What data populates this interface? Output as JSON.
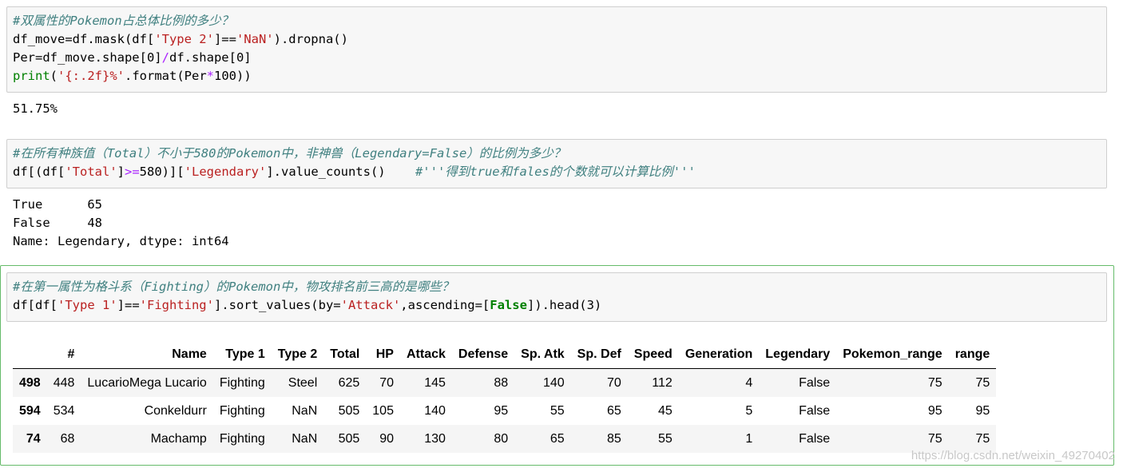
{
  "cell1": {
    "lines": [
      [
        {
          "c": "cm",
          "t": "#双属性的Pokemon占总体比例的多少？"
        }
      ],
      [
        {
          "c": "",
          "t": "df_move=df.mask(df["
        },
        {
          "c": "st",
          "t": "'Type 2'"
        },
        {
          "c": "",
          "t": "]=="
        },
        {
          "c": "st",
          "t": "'NaN'"
        },
        {
          "c": "",
          "t": ").dropna()"
        }
      ],
      [
        {
          "c": "",
          "t": "Per=df_move.shape[0]"
        },
        {
          "c": "op",
          "t": "/"
        },
        {
          "c": "",
          "t": "df.shape[0]"
        }
      ],
      [
        {
          "c": "bi",
          "t": "print"
        },
        {
          "c": "",
          "t": "("
        },
        {
          "c": "st",
          "t": "'{:.2f}%'"
        },
        {
          "c": "",
          "t": ".format(Per"
        },
        {
          "c": "op",
          "t": "*"
        },
        {
          "c": "",
          "t": "100))"
        }
      ]
    ],
    "output": [
      "51.75%"
    ]
  },
  "cell2": {
    "lines": [
      [
        {
          "c": "cm",
          "t": "#在所有种族值（Total）不小于580的Pokemon中，非神兽（Legendary=False）的比例为多少？"
        }
      ],
      [
        {
          "c": "",
          "t": "df[(df["
        },
        {
          "c": "st",
          "t": "'Total'"
        },
        {
          "c": "",
          "t": "]"
        },
        {
          "c": "op",
          "t": ">="
        },
        {
          "c": "",
          "t": "580)]["
        },
        {
          "c": "st",
          "t": "'Legendary'"
        },
        {
          "c": "",
          "t": "].value_counts()    "
        },
        {
          "c": "cm",
          "t": "#'''得到true和fales的个数就可以计算比例'''"
        }
      ]
    ],
    "output": [
      "True      65",
      "False     48",
      "Name: Legendary, dtype: int64"
    ]
  },
  "cell3": {
    "lines": [
      [
        {
          "c": "cm",
          "t": "#在第一属性为格斗系（Fighting）的Pokemon中，物攻排名前三高的是哪些？"
        }
      ],
      [
        {
          "c": "",
          "t": "df[df["
        },
        {
          "c": "st",
          "t": "'Type 1'"
        },
        {
          "c": "",
          "t": "]=="
        },
        {
          "c": "st",
          "t": "'Fighting'"
        },
        {
          "c": "",
          "t": "].sort_values(by="
        },
        {
          "c": "st",
          "t": "'Attack'"
        },
        {
          "c": "",
          "t": ",ascending=["
        },
        {
          "c": "kw",
          "t": "False"
        },
        {
          "c": "",
          "t": "]).head(3)"
        }
      ]
    ],
    "table": {
      "columns": [
        "",
        "#",
        "Name",
        "Type 1",
        "Type 2",
        "Total",
        "HP",
        "Attack",
        "Defense",
        "Sp. Atk",
        "Sp. Def",
        "Speed",
        "Generation",
        "Legendary",
        "Pokemon_range",
        "range"
      ],
      "rows": [
        [
          "498",
          "448",
          "LucarioMega Lucario",
          "Fighting",
          "Steel",
          "625",
          "70",
          "145",
          "88",
          "140",
          "70",
          "112",
          "4",
          "False",
          "75",
          "75"
        ],
        [
          "594",
          "534",
          "Conkeldurr",
          "Fighting",
          "NaN",
          "505",
          "105",
          "140",
          "95",
          "55",
          "65",
          "45",
          "5",
          "False",
          "95",
          "95"
        ],
        [
          "74",
          "68",
          "Machamp",
          "Fighting",
          "NaN",
          "505",
          "90",
          "130",
          "80",
          "65",
          "85",
          "55",
          "1",
          "False",
          "75",
          "75"
        ]
      ]
    }
  },
  "watermark": "https://blog.csdn.net/weixin_49270402"
}
